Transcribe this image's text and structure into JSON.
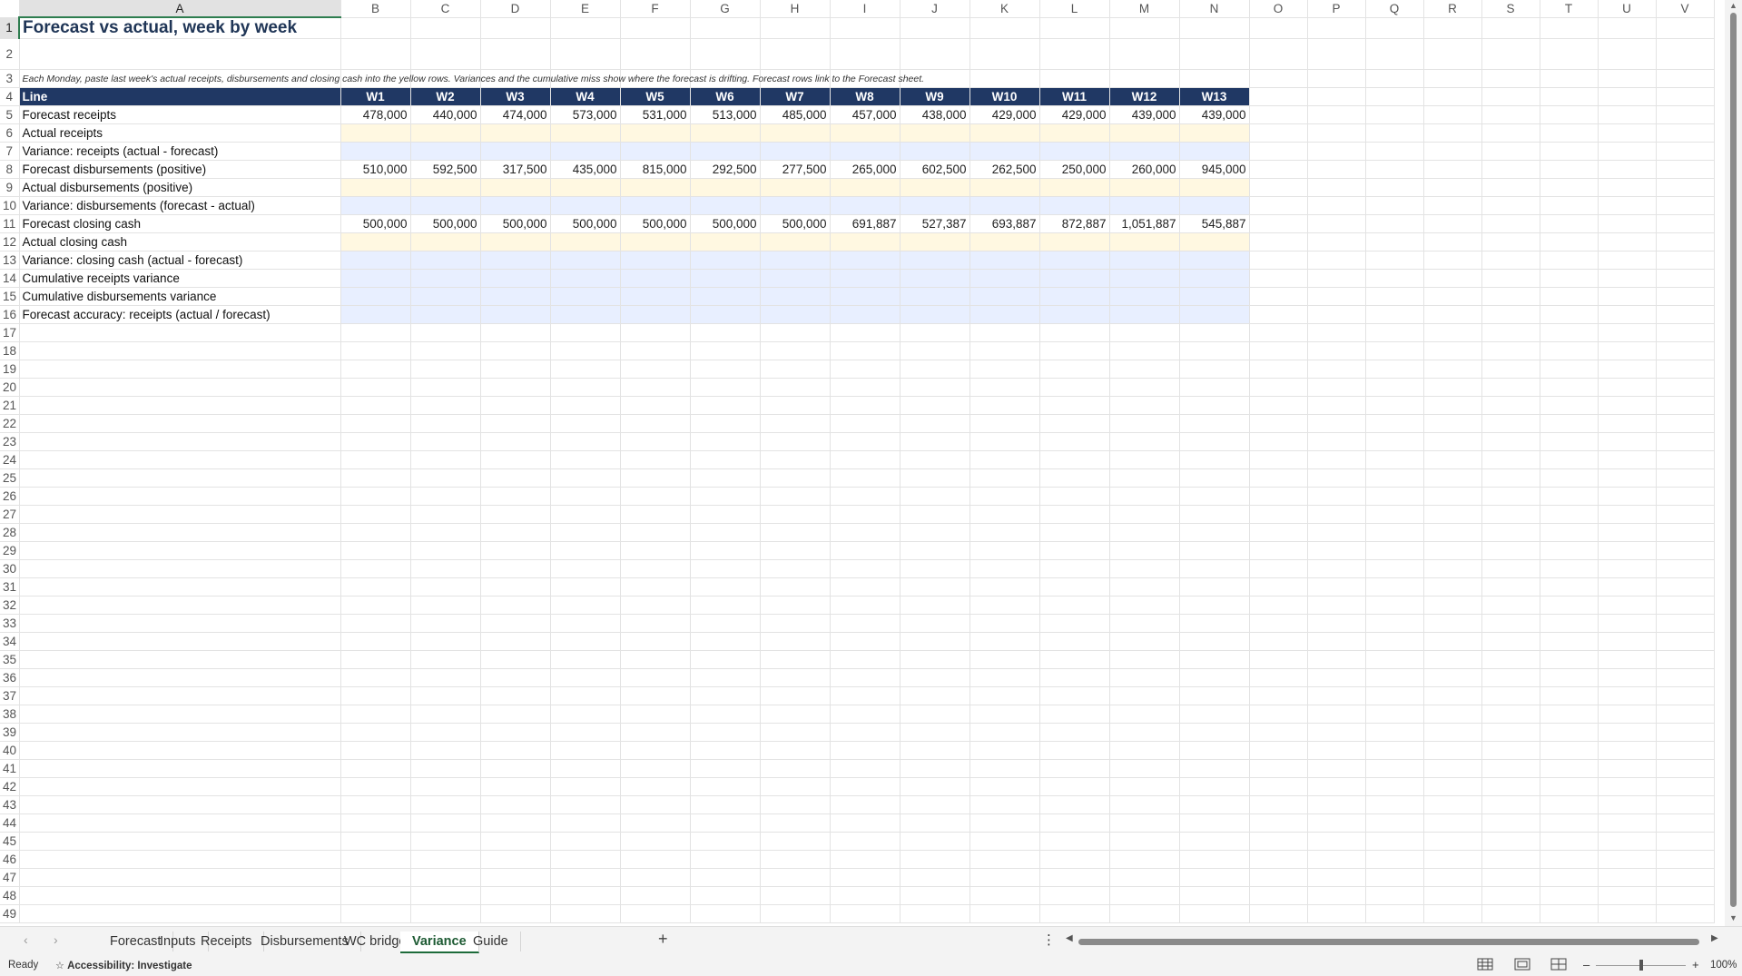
{
  "columns": [
    "A",
    "B",
    "C",
    "D",
    "E",
    "F",
    "G",
    "H",
    "I",
    "J",
    "K",
    "L",
    "M",
    "N",
    "O",
    "P",
    "Q",
    "R",
    "S",
    "T",
    "U",
    "V"
  ],
  "title": "Forecast vs actual, week by week",
  "note": "Each Monday, paste last week's actual receipts, disbursements and closing cash into the yellow rows. Variances and the cumulative miss show where the forecast is drifting. Forecast rows link to the Forecast sheet.",
  "header": {
    "label": "Line",
    "weeks": [
      "W1",
      "W2",
      "W3",
      "W4",
      "W5",
      "W6",
      "W7",
      "W8",
      "W9",
      "W10",
      "W11",
      "W12",
      "W13"
    ]
  },
  "rows": [
    {
      "label": "Forecast receipts",
      "kind": "forecast",
      "values": [
        "478,000",
        "440,000",
        "474,000",
        "573,000",
        "531,000",
        "513,000",
        "485,000",
        "457,000",
        "438,000",
        "429,000",
        "429,000",
        "439,000",
        "439,000"
      ]
    },
    {
      "label": "Actual receipts",
      "kind": "input",
      "values": []
    },
    {
      "label": "Variance: receipts (actual - forecast)",
      "kind": "calc",
      "values": []
    },
    {
      "label": "Forecast disbursements (positive)",
      "kind": "forecast",
      "values": [
        "510,000",
        "592,500",
        "317,500",
        "435,000",
        "815,000",
        "292,500",
        "277,500",
        "265,000",
        "602,500",
        "262,500",
        "250,000",
        "260,000",
        "945,000"
      ]
    },
    {
      "label": "Actual disbursements (positive)",
      "kind": "input",
      "values": []
    },
    {
      "label": "Variance: disbursements (forecast - actual)",
      "kind": "calc",
      "values": []
    },
    {
      "label": "Forecast closing cash",
      "kind": "forecast",
      "values": [
        "500,000",
        "500,000",
        "500,000",
        "500,000",
        "500,000",
        "500,000",
        "500,000",
        "691,887",
        "527,387",
        "693,887",
        "872,887",
        "1,051,887",
        "545,887"
      ]
    },
    {
      "label": "Actual closing cash",
      "kind": "input",
      "values": []
    },
    {
      "label": "Variance: closing cash (actual - forecast)",
      "kind": "calc",
      "values": []
    },
    {
      "label": "Cumulative receipts variance",
      "kind": "calc",
      "values": []
    },
    {
      "label": "Cumulative disbursements variance",
      "kind": "calc",
      "values": []
    },
    {
      "label": "Forecast accuracy: receipts (actual / forecast)",
      "kind": "calc",
      "values": []
    }
  ],
  "total_rows": 49,
  "sheets": [
    "Forecast",
    "Inputs",
    "Receipts",
    "Disbursements",
    "WC bridge",
    "Variance",
    "Guide"
  ],
  "active_sheet": "Variance",
  "status": {
    "ready": "Ready",
    "accessibility": "Accessibility: Investigate",
    "zoom": "100%"
  },
  "colors": {
    "header_fill": "#203864",
    "input_fill": "#fff8e1",
    "calc_fill": "#e8efff",
    "title_color": "#1f3556",
    "selection": "#2e7d4f"
  }
}
